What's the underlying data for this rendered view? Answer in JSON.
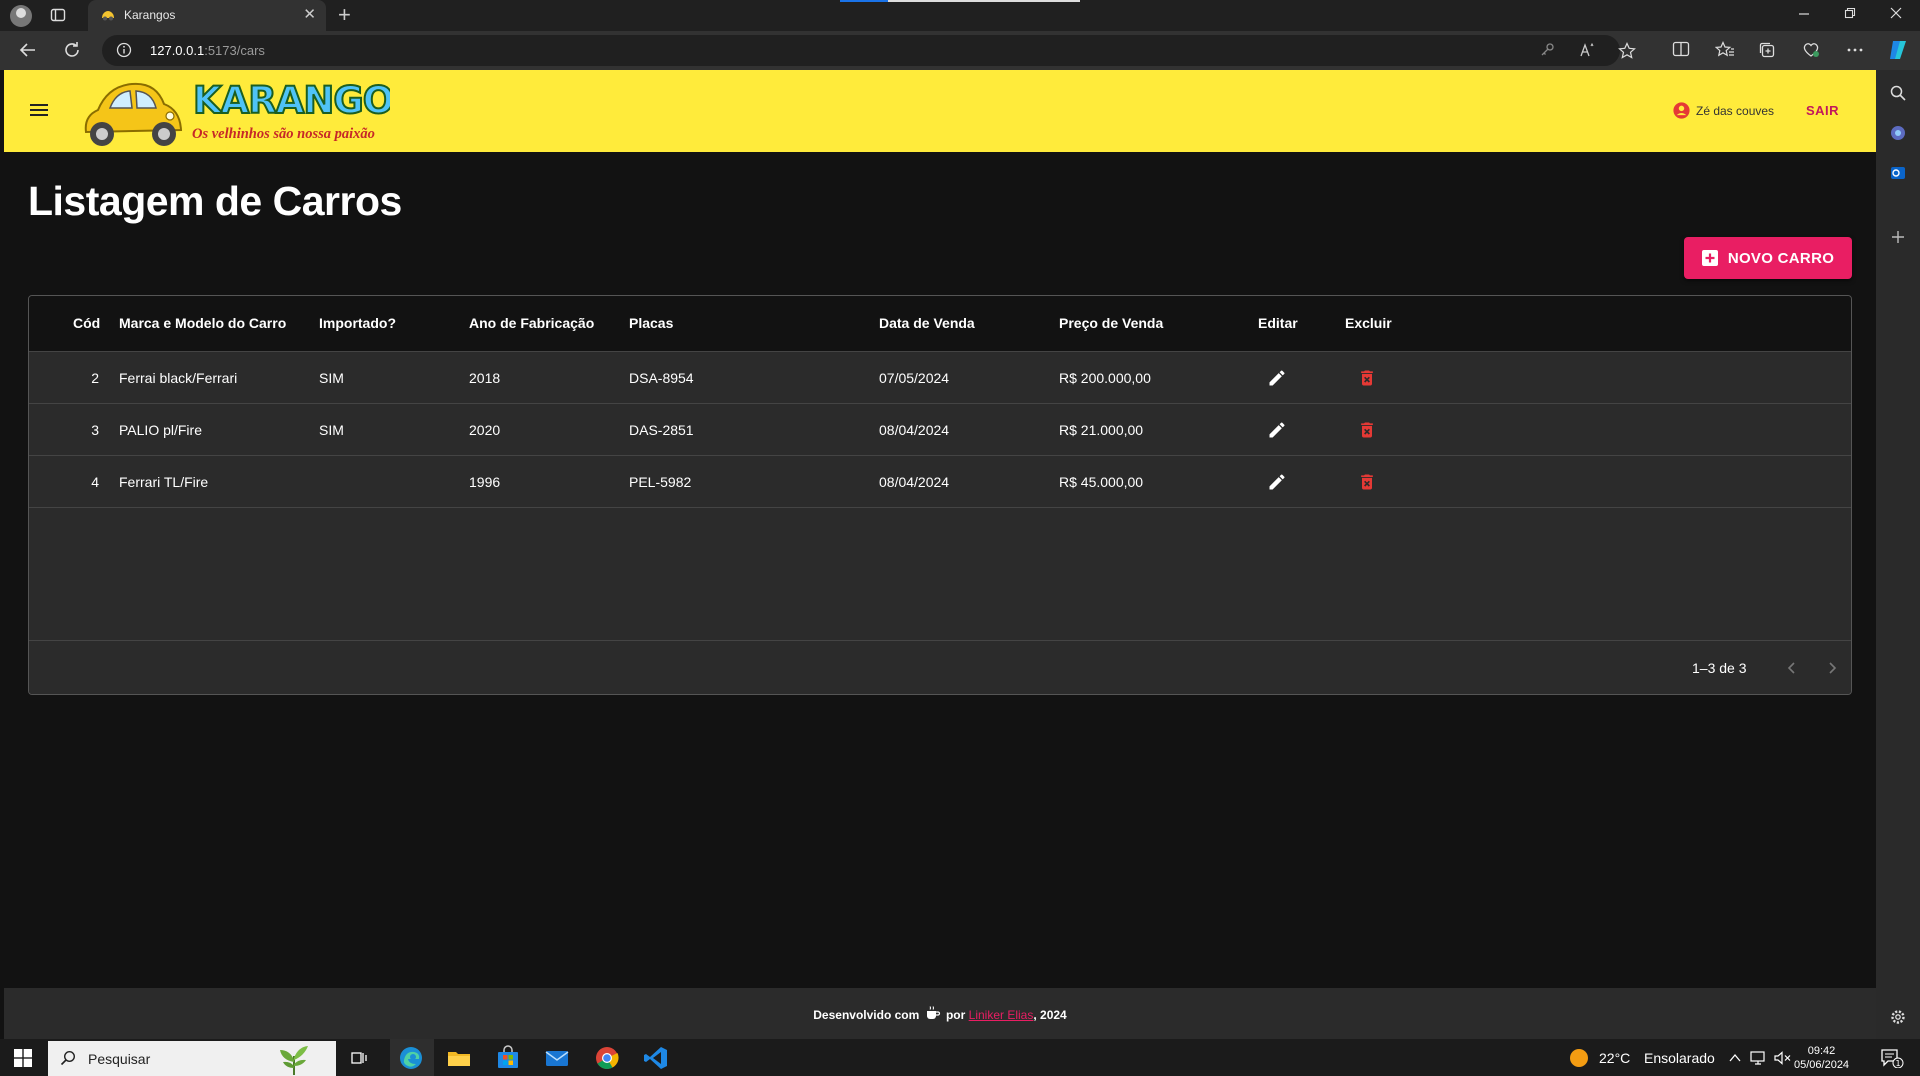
{
  "browser": {
    "tab_title": "Karangos",
    "url_host": "127.0.0.1",
    "url_path": ":5173/cars",
    "new_tab_symbol": "+",
    "close_symbol": "✕"
  },
  "app": {
    "brand": "KARANGOS",
    "tagline": "Os velhinhos são nossa paixão",
    "user_name": "Zé das couves",
    "logout_label": "SAIR",
    "page_title": "Listagem de Carros",
    "new_car_label": "NOVO CARRO",
    "colors": {
      "appbar": "#ffeb3b",
      "accent": "#e91e63",
      "delete": "#e53935"
    }
  },
  "table": {
    "columns": [
      "Cód",
      "Marca e Modelo do Carro",
      "Importado?",
      "Ano de Fabricação",
      "Placas",
      "Data de Venda",
      "Preço de Venda",
      "Editar",
      "Excluir"
    ],
    "rows": [
      {
        "id": "2",
        "model": "Ferrai black/Ferrari",
        "imported": "SIM",
        "year": "2018",
        "plate": "DSA-8954",
        "sale_date": "07/05/2024",
        "price": "R$ 200.000,00"
      },
      {
        "id": "3",
        "model": "PALIO pl/Fire",
        "imported": "SIM",
        "year": "2020",
        "plate": "DAS-2851",
        "sale_date": "08/04/2024",
        "price": "R$ 21.000,00"
      },
      {
        "id": "4",
        "model": "Ferrari TL/Fire",
        "imported": "",
        "year": "1996",
        "plate": "PEL-5982",
        "sale_date": "08/04/2024",
        "price": "R$ 45.000,00"
      }
    ],
    "pagination": "1–3 de 3"
  },
  "footer": {
    "prefix": "Desenvolvido com",
    "by": "por",
    "author": "Liniker Elias",
    "year_suffix": ", 2024"
  },
  "taskbar": {
    "search_placeholder": "Pesquisar",
    "weather_temp": "22°C",
    "weather_text": "Ensolarado",
    "time": "09:42",
    "date": "05/06/2024",
    "notification_count": "1"
  }
}
